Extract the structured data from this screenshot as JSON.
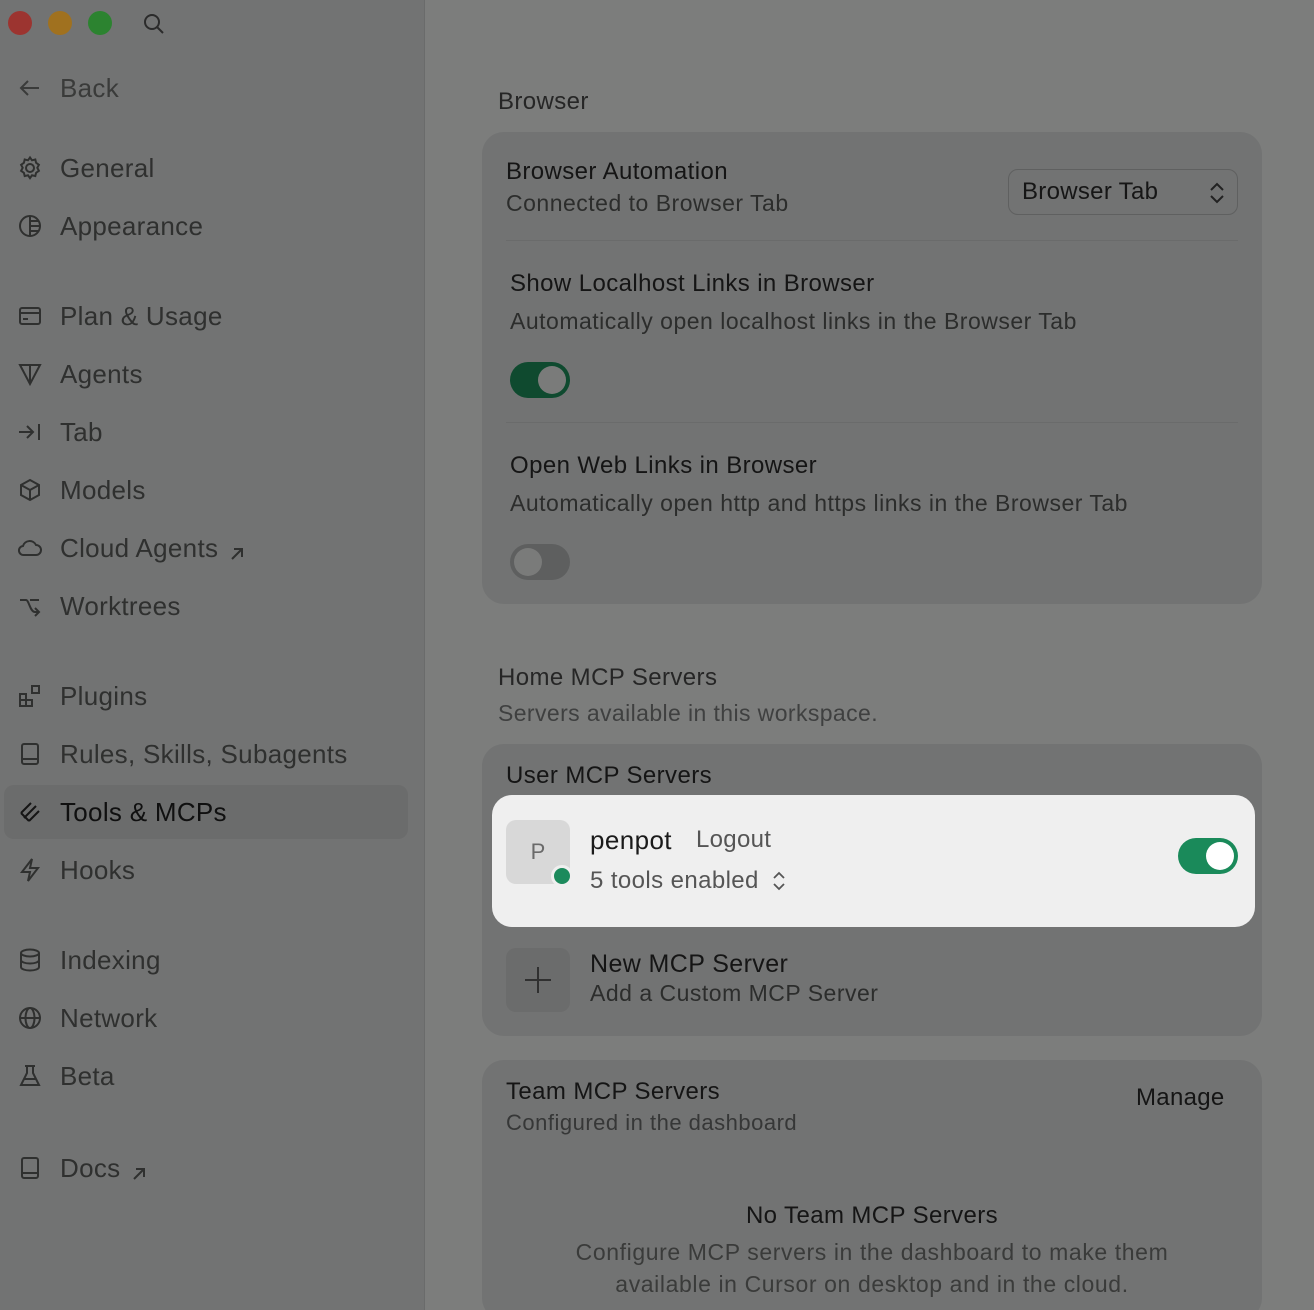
{
  "sidebar": {
    "back_label": "Back",
    "items": [
      {
        "label": "General",
        "icon": "gear-icon"
      },
      {
        "label": "Appearance",
        "icon": "appearance-icon"
      },
      {
        "label": "Plan & Usage",
        "icon": "card-icon"
      },
      {
        "label": "Agents",
        "icon": "agents-icon"
      },
      {
        "label": "Tab",
        "icon": "tab-icon"
      },
      {
        "label": "Models",
        "icon": "cube-icon"
      },
      {
        "label": "Cloud Agents",
        "icon": "cloud-icon"
      },
      {
        "label": "Worktrees",
        "icon": "branch-icon"
      },
      {
        "label": "Plugins",
        "icon": "plugins-icon"
      },
      {
        "label": "Rules, Skills, Subagents",
        "icon": "book-icon"
      },
      {
        "label": "Tools & MCPs",
        "icon": "tools-icon"
      },
      {
        "label": "Hooks",
        "icon": "bolt-icon"
      },
      {
        "label": "Indexing",
        "icon": "database-icon"
      },
      {
        "label": "Network",
        "icon": "globe-icon"
      },
      {
        "label": "Beta",
        "icon": "flask-icon"
      },
      {
        "label": "Docs",
        "icon": "book-icon"
      }
    ],
    "active": "Tools & MCPs"
  },
  "browser": {
    "section_title": "Browser",
    "automation_title": "Browser Automation",
    "automation_sub": "Connected to Browser Tab",
    "automation_select": "Browser Tab",
    "localhost_title": "Show Localhost Links in Browser",
    "localhost_sub": "Automatically open localhost links in the Browser Tab",
    "localhost_enabled": true,
    "web_title": "Open Web Links in Browser",
    "web_sub": "Automatically open http and https links in the Browser Tab",
    "web_enabled": false
  },
  "home_mcp": {
    "section_title": "Home MCP Servers",
    "section_sub": "Servers available in this workspace.",
    "user_title": "User MCP Servers",
    "server": {
      "initial": "P",
      "name": "penpot",
      "logout": "Logout",
      "tools": "5 tools enabled",
      "enabled": true,
      "status_color": "#1c8a5c"
    },
    "new_title": "New MCP Server",
    "new_sub": "Add a Custom MCP Server"
  },
  "team_mcp": {
    "title": "Team MCP Servers",
    "sub": "Configured in the dashboard",
    "manage": "Manage",
    "empty_title": "No Team MCP Servers",
    "empty_line1": "Configure MCP servers in the dashboard to make them",
    "empty_line2": "available in Cursor on desktop and in the cloud."
  }
}
